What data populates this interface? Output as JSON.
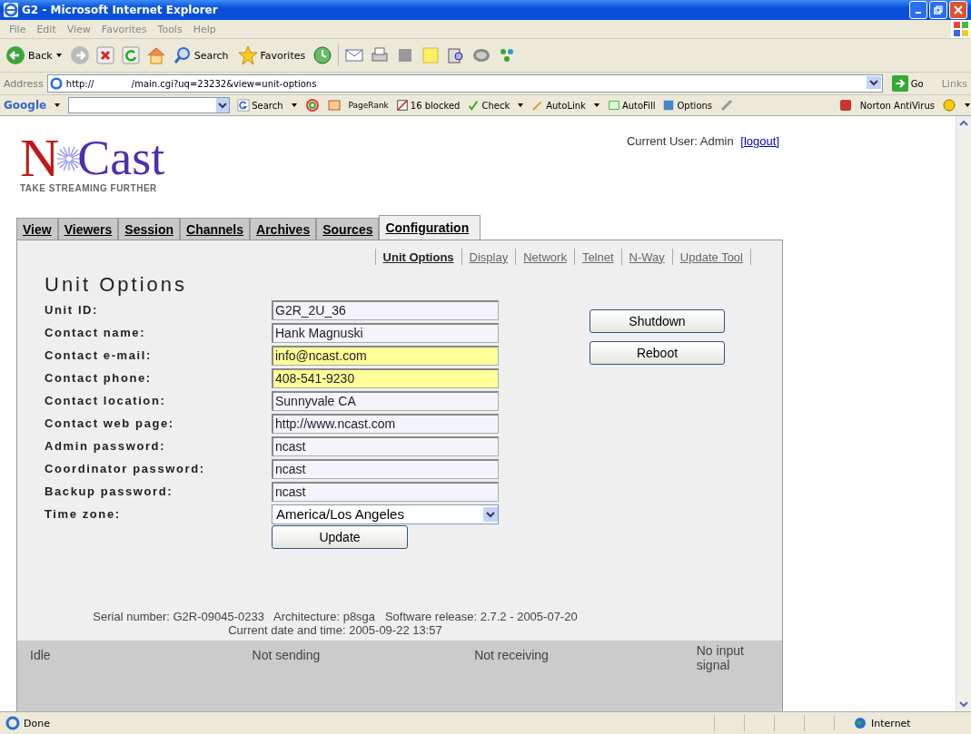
{
  "window": {
    "title": "G2 - Microsoft Internet Explorer"
  },
  "menu": [
    "File",
    "Edit",
    "View",
    "Favorites",
    "Tools",
    "Help"
  ],
  "toolbar": {
    "back": "Back",
    "search": "Search",
    "favorites": "Favorites"
  },
  "address": {
    "label": "Address",
    "url_parts": [
      "http://",
      "/main.cgi?uq=23232&view=unit-options"
    ],
    "go": "Go",
    "links": "Links"
  },
  "google_bar": {
    "logo": "Google",
    "search": "Search",
    "pagerank": "PageRank",
    "blocked": "16 blocked",
    "check": "Check",
    "autolink": "AutoLink",
    "autofill": "AutoFill",
    "options": "Options",
    "norton": "Norton AntiVirus"
  },
  "logo": {
    "initial": "N",
    "rest": "Cast",
    "tagline": "TAKE STREAMING FURTHER"
  },
  "user": {
    "text": "Current User: Admin",
    "logout": "[logout]"
  },
  "tabs": [
    {
      "label": "View",
      "selected": false
    },
    {
      "label": "Viewers",
      "selected": false
    },
    {
      "label": "Session",
      "selected": false
    },
    {
      "label": "Channels",
      "selected": false
    },
    {
      "label": "Archives",
      "selected": false
    },
    {
      "label": "Sources",
      "selected": false
    },
    {
      "label": "Configuration",
      "selected": true
    }
  ],
  "subtabs": [
    {
      "label": "Unit Options",
      "selected": true
    },
    {
      "label": "Display",
      "selected": false
    },
    {
      "label": "Network",
      "selected": false
    },
    {
      "label": "Telnet",
      "selected": false
    },
    {
      "label": "N-Way",
      "selected": false
    },
    {
      "label": "Update Tool",
      "selected": false
    }
  ],
  "heading": "Unit Options",
  "fields": [
    {
      "kind": "text",
      "label": "Unit ID:",
      "value": "G2R_2U_36",
      "highlighted": false
    },
    {
      "kind": "text",
      "label": "Contact name:",
      "value": "Hank Magnuski",
      "highlighted": false
    },
    {
      "kind": "text",
      "label": "Contact e-mail:",
      "value": "info@ncast.com",
      "highlighted": true
    },
    {
      "kind": "text",
      "label": "Contact phone:",
      "value": "408-541-9230",
      "highlighted": true
    },
    {
      "kind": "text",
      "label": "Contact location:",
      "value": "Sunnyvale CA",
      "highlighted": false
    },
    {
      "kind": "text",
      "label": "Contact web page:",
      "value": "http://www.ncast.com",
      "highlighted": false
    },
    {
      "kind": "text",
      "label": "Admin password:",
      "value": "ncast",
      "highlighted": false
    },
    {
      "kind": "text",
      "label": "Coordinator password:",
      "value": "ncast",
      "highlighted": false
    },
    {
      "kind": "text",
      "label": "Backup password:",
      "value": "ncast",
      "highlighted": false
    },
    {
      "kind": "select",
      "label": "Time zone:",
      "value": "America/Los Angeles"
    }
  ],
  "update_button": "Update",
  "side_buttons": [
    "Shutdown",
    "Reboot"
  ],
  "footer": {
    "info": "Serial number: G2R-09045-0233   Architecture: p8sga   Software release: 2.7.2 - 2005-07-20",
    "date": "Current date and time: 2005-09-22 13:57"
  },
  "status_strip": [
    "Idle",
    "Not sending",
    "Not receiving",
    "No input signal"
  ],
  "status_bar": {
    "text": "Done",
    "zone": "Internet"
  }
}
